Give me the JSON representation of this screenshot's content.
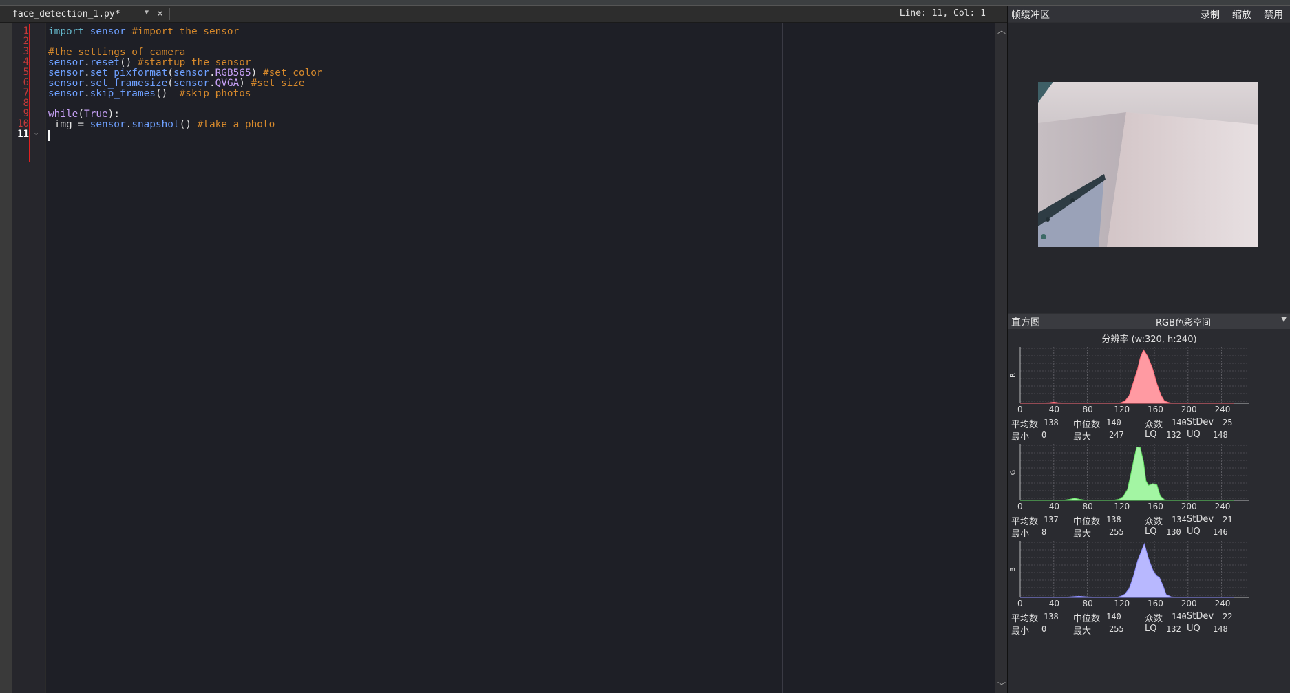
{
  "editor": {
    "tab_title": "face_detection_1.py*",
    "status": "Line: 11, Col: 1",
    "line_numbers": [
      "1",
      "2",
      "3",
      "4",
      "5",
      "6",
      "7",
      "8",
      "9",
      "10",
      "11"
    ]
  },
  "framebuffer": {
    "title": "帧缓冲区",
    "record_label": "录制",
    "zoom_label": "缩放",
    "disable_label": "禁用"
  },
  "histogram": {
    "title": "直方图",
    "color_space": "RGB色彩空间",
    "resolution": "分辨率 (w:320, h:240)",
    "x_ticks": [
      "0",
      "40",
      "80",
      "120",
      "160",
      "200",
      "240"
    ],
    "labels": {
      "mean": "平均数",
      "median": "中位数",
      "mode": "众数",
      "stdev": "StDev",
      "min": "最小",
      "max": "最大",
      "lq": "LQ",
      "uq": "UQ"
    },
    "channels": [
      {
        "name": "R",
        "color": "#ff9aa2",
        "stroke": "#ff6b78",
        "mean": "138",
        "median": "140",
        "mode": "140",
        "stdev": "25",
        "min": "0",
        "max": "247",
        "lq": "132",
        "uq": "148",
        "bins": [
          [
            0,
            0
          ],
          [
            20,
            0
          ],
          [
            35,
            1
          ],
          [
            40,
            2
          ],
          [
            45,
            1
          ],
          [
            60,
            0
          ],
          [
            100,
            0
          ],
          [
            115,
            0
          ],
          [
            120,
            1
          ],
          [
            125,
            4
          ],
          [
            130,
            14
          ],
          [
            135,
            38
          ],
          [
            140,
            62
          ],
          [
            143,
            82
          ],
          [
            147,
            97
          ],
          [
            152,
            85
          ],
          [
            158,
            62
          ],
          [
            163,
            35
          ],
          [
            168,
            14
          ],
          [
            172,
            4
          ],
          [
            178,
            1
          ],
          [
            185,
            0
          ],
          [
            240,
            0
          ],
          [
            255,
            0
          ]
        ]
      },
      {
        "name": "G",
        "color": "#a3f5a3",
        "stroke": "#64e064",
        "mean": "137",
        "median": "138",
        "mode": "134",
        "stdev": "21",
        "min": "8",
        "max": "255",
        "lq": "130",
        "uq": "146",
        "bins": [
          [
            0,
            0
          ],
          [
            50,
            0
          ],
          [
            60,
            2
          ],
          [
            65,
            4
          ],
          [
            70,
            2
          ],
          [
            80,
            0
          ],
          [
            110,
            0
          ],
          [
            118,
            2
          ],
          [
            123,
            7
          ],
          [
            128,
            20
          ],
          [
            132,
            48
          ],
          [
            136,
            78
          ],
          [
            139,
            97
          ],
          [
            143,
            96
          ],
          [
            147,
            70
          ],
          [
            150,
            35
          ],
          [
            153,
            27
          ],
          [
            158,
            30
          ],
          [
            163,
            28
          ],
          [
            167,
            8
          ],
          [
            172,
            1
          ],
          [
            180,
            0
          ],
          [
            240,
            0
          ],
          [
            255,
            0
          ]
        ]
      },
      {
        "name": "B",
        "color": "#b8b8ff",
        "stroke": "#8f8fff",
        "mean": "138",
        "median": "140",
        "mode": "140",
        "stdev": "22",
        "min": "0",
        "max": "255",
        "lq": "132",
        "uq": "148",
        "bins": [
          [
            0,
            0
          ],
          [
            50,
            0
          ],
          [
            60,
            1
          ],
          [
            70,
            2
          ],
          [
            80,
            1
          ],
          [
            100,
            0
          ],
          [
            115,
            0
          ],
          [
            120,
            2
          ],
          [
            125,
            6
          ],
          [
            130,
            16
          ],
          [
            135,
            38
          ],
          [
            140,
            66
          ],
          [
            144,
            82
          ],
          [
            148,
            97
          ],
          [
            153,
            70
          ],
          [
            158,
            50
          ],
          [
            162,
            40
          ],
          [
            166,
            36
          ],
          [
            170,
            22
          ],
          [
            174,
            5
          ],
          [
            180,
            1
          ],
          [
            190,
            0
          ],
          [
            240,
            0
          ],
          [
            255,
            0
          ]
        ]
      }
    ]
  }
}
